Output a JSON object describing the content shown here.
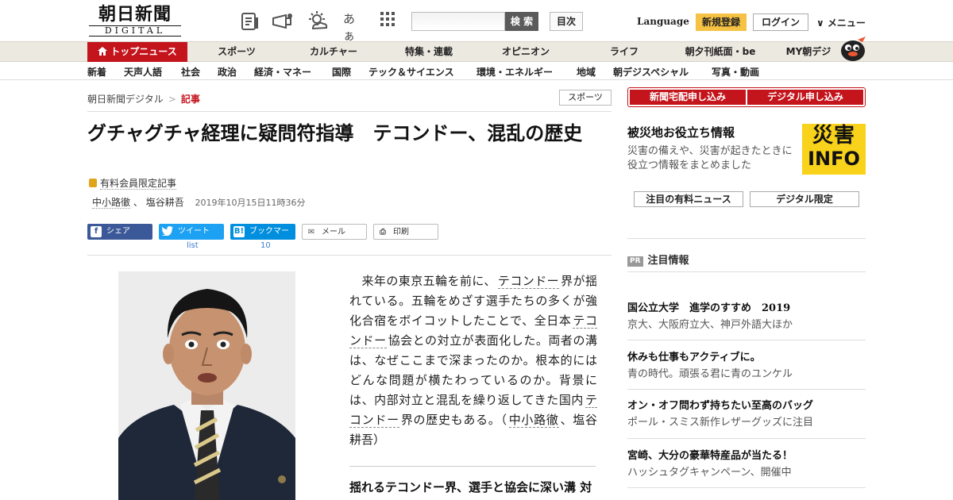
{
  "header": {
    "logo_main": "朝日新聞",
    "logo_sub": "DIGITAL",
    "search_button": "検 索",
    "toc_button": "目次",
    "language": "Language",
    "register_button": "新規登録",
    "login_button": "ログイン",
    "menu_button": "∨ メニュー",
    "icons": [
      "newspaper-icon",
      "megaphone-icon",
      "weather-icon",
      "font-size-icon",
      "grid-icon"
    ],
    "font_size_glyph": "あぁ"
  },
  "main_nav": [
    "トップニュース",
    "スポーツ",
    "カルチャー",
    "特集・連載",
    "オピニオン",
    "ライフ",
    "朝夕刊紙面・be",
    "MY朝デジ"
  ],
  "sub_nav": [
    "新着",
    "天声人語",
    "社会",
    "政治",
    "経済・マネー",
    "国際",
    "テック＆サイエンス",
    "環境・エネルギー",
    "地域",
    "朝デジスペシャル",
    "写真・動画"
  ],
  "breadcrumb": {
    "home": "朝日新聞デジタル",
    "sep": ">",
    "current": "記事"
  },
  "category_tag": "スポーツ",
  "article": {
    "title": "グチャグチャ経理に疑問符指導　テコンドー、混乱の歴史",
    "members_only": "有料会員限定記事",
    "author1": "中小路徹",
    "author_sep": "、",
    "author2": "塩谷耕吾",
    "date": "2019年10月15日11時36分",
    "body": {
      "p1": "　来年の東京五輪を前に、",
      "link1": "テコンドー",
      "p2": "界が揺れている。五輪をめざす選手たちの多くが強化合宿をボイコットしたことで、全日本",
      "link2": "テコンドー",
      "p3": "協会との対立が表面化した。両者の溝は、なぜここまで深まったのか。根本的にはどんな問題が横たわっているのか。背景には、内部対立と混乱を繰り返してきた国内",
      "link3": "テコンドー",
      "p4": "界の歴史もある。（",
      "link4": "中小路徹",
      "p5": "、塩谷耕吾）"
    },
    "section_head": "揺れるテコンドー界、選手と協会に深い溝 対立の背景は"
  },
  "share": {
    "facebook": "シェア",
    "twitter": "ツイート",
    "hatena": "ブックマーク",
    "mail": "メール",
    "print": "印刷",
    "twitter_count": "list",
    "hatena_count": "10"
  },
  "sidebar": {
    "subscribe_paper": "新聞宅配申し込み",
    "subscribe_digital": "デジタル申し込み",
    "disaster_title": "被災地お役立ち情報",
    "disaster_desc": "災害の備えや、災害が起きたときに役立つ情報をまとめました",
    "disaster_logo_kanji": "災害",
    "disaster_logo_info": "INFO",
    "btn_paid_news": "注目の有料ニュース",
    "btn_digital_only": "デジタル限定",
    "pr_label": "PR",
    "pr_heading": "注目情報",
    "pr_items": [
      {
        "title": "国公立大学　進学のすすめ　2019",
        "desc": "京大、大阪府立大、神戸外語大ほか"
      },
      {
        "title": "休みも仕事もアクティブに。",
        "desc": "青の時代。頑張る君に青のユンケル"
      },
      {
        "title": "オン・オフ問わず持ちたい至高のバッグ",
        "desc": "ポール・スミス新作レザーグッズに注目"
      },
      {
        "title": "宮崎、大分の豪華特産品が当たる！",
        "desc": "ハッシュタグキャンペーン、開催中"
      }
    ]
  },
  "colors": {
    "accent_red": "#c4141c",
    "register_yellow": "#f6c244",
    "facebook": "#3b5998",
    "twitter": "#1da1f2",
    "hatena": "#008fde",
    "disaster_yellow": "#f9d21b"
  }
}
